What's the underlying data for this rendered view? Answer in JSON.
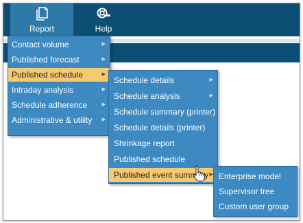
{
  "toolbar": {
    "report": {
      "label": "Report",
      "icon": "document-stack-icon"
    },
    "help": {
      "label": "Help",
      "icon": "lifebuoy-icon"
    }
  },
  "report_menu": {
    "items": [
      {
        "label": "Contact volume",
        "submenu": true
      },
      {
        "label": "Published forecast",
        "submenu": true
      },
      {
        "label": "Published schedule",
        "submenu": true,
        "highlighted": true
      },
      {
        "label": "Intraday analysis",
        "submenu": true
      },
      {
        "label": "Schedule adherence",
        "submenu": true
      },
      {
        "label": "Administrative & utility",
        "submenu": true
      }
    ]
  },
  "published_schedule_menu": {
    "items": [
      {
        "label": "Schedule details",
        "submenu": true
      },
      {
        "label": "Schedule analysis",
        "submenu": true
      },
      {
        "label": "Schedule summary (printer)",
        "submenu": false
      },
      {
        "label": "Schedule details (printer)",
        "submenu": false
      },
      {
        "label": "Shrinkage report",
        "submenu": false
      },
      {
        "label": "Published schedule",
        "submenu": false
      },
      {
        "label": "Published event summary",
        "submenu": true,
        "highlighted": true
      }
    ]
  },
  "event_summary_menu": {
    "items": [
      {
        "label": "Enterprise model"
      },
      {
        "label": "Supervisor tree"
      },
      {
        "label": "Custom user group"
      }
    ]
  },
  "colors": {
    "toolbar": "#0d4f74",
    "menu": "#3d8ac3",
    "highlight": "#f7c970"
  }
}
